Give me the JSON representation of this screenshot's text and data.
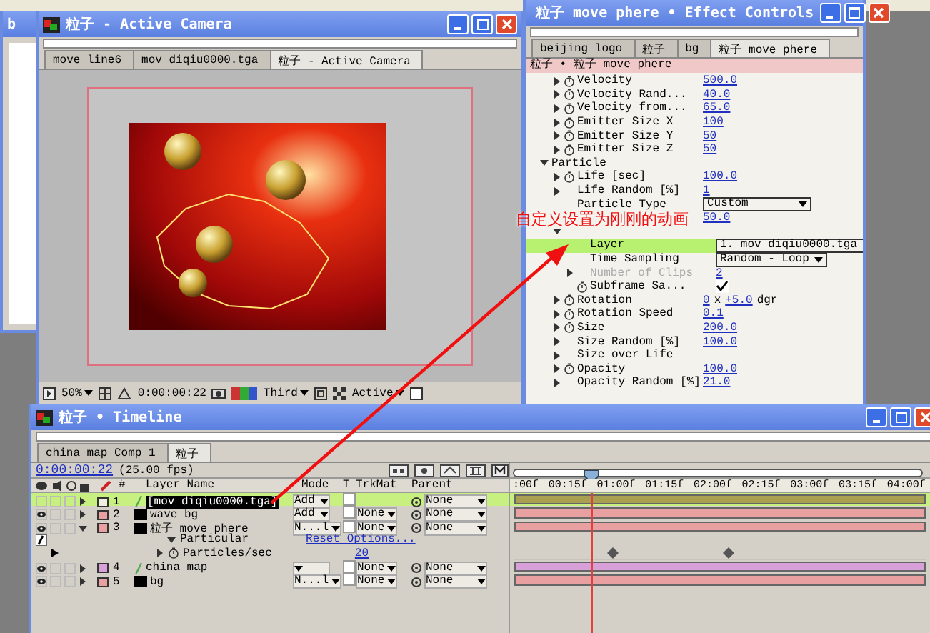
{
  "background_window": {
    "title": "b"
  },
  "camera_window": {
    "title": "粒子 - Active Camera",
    "tabs": [
      {
        "label": "move line6",
        "selected": false
      },
      {
        "label": "mov diqiu0000.tga",
        "selected": false
      },
      {
        "label": "粒子 - Active Camera",
        "selected": true
      }
    ],
    "toolbar": {
      "zoom": "50%",
      "time": "0:00:00:22",
      "resolution": "Third",
      "view": "Active"
    }
  },
  "effect_controls": {
    "title": "粒子 move phere • Effect Controls",
    "tabs": [
      {
        "label": "beijing logo",
        "selected": false
      },
      {
        "label": "粒子",
        "selected": false
      },
      {
        "label": "bg",
        "selected": false
      },
      {
        "label": "粒子 move phere",
        "selected": true
      }
    ],
    "path": "粒子 • 粒子 move phere",
    "scrolled_rows": [
      {
        "kind": "value",
        "label": "Velocity",
        "value": "500.0",
        "stopwatch": true,
        "twirl": true
      },
      {
        "kind": "value",
        "label": "Velocity Rand...",
        "value": "40.0",
        "stopwatch": true,
        "twirl": true
      },
      {
        "kind": "value",
        "label": "Velocity from...",
        "value": "65.0",
        "stopwatch": true,
        "twirl": true
      },
      {
        "kind": "value",
        "label": "Emitter Size X",
        "value": "100",
        "stopwatch": true,
        "twirl": true
      },
      {
        "kind": "value",
        "label": "Emitter Size Y",
        "value": "50",
        "stopwatch": true,
        "twirl": true
      },
      {
        "kind": "value",
        "label": "Emitter Size Z",
        "value": "50",
        "stopwatch": true,
        "twirl": true
      }
    ],
    "groups": [
      {
        "label": "Particle",
        "expanded": true,
        "children": [
          {
            "kind": "value",
            "label": "Life [sec]",
            "value": "100.0",
            "stopwatch": true,
            "twirl": true
          },
          {
            "kind": "value",
            "label": "Life Random [%]",
            "value": "1",
            "stopwatch": false,
            "twirl": true
          },
          {
            "kind": "dropdown",
            "label": "Particle Type",
            "value": "Custom",
            "stopwatch": false,
            "twirl": false
          },
          {
            "kind": "value",
            "value": "50.0",
            "disabled": true
          },
          {
            "kind": "group",
            "expanded": true,
            "children": [
              {
                "kind": "dropdown",
                "label": "Layer",
                "value": "1. mov diqiu0000.tga",
                "stopwatch": false,
                "twirl": false,
                "highlighted": true
              },
              {
                "kind": "dropdown",
                "label": "Time Sampling",
                "value": "Random - Loop",
                "stopwatch": false,
                "twirl": false,
                "highlighted": false
              },
              {
                "kind": "value",
                "label": "Number of Clips",
                "value": "2",
                "stopwatch": false,
                "twirl": true,
                "disabled": true,
                "highlighted": false
              },
              {
                "kind": "checkbox",
                "label": "Subframe Sa...",
                "checked": true,
                "stopwatch": true,
                "twirl": false,
                "highlighted": false
              }
            ]
          },
          {
            "kind": "rotation",
            "label": "Rotation",
            "revolutions": "0",
            "separator": "x",
            "degrees": "+5.0",
            "unit": "dgr",
            "stopwatch": true,
            "twirl": true
          },
          {
            "kind": "value",
            "label": "Rotation Speed",
            "value": "0.1",
            "stopwatch": true,
            "twirl": true
          },
          {
            "kind": "value",
            "label": "Size",
            "value": "200.0",
            "stopwatch": true,
            "twirl": true
          },
          {
            "kind": "value",
            "label": "Size Random [%]",
            "value": "100.0",
            "stopwatch": false,
            "twirl": true
          },
          {
            "kind": "plain",
            "label": "Size over Life",
            "stopwatch": false,
            "twirl": true
          },
          {
            "kind": "value",
            "label": "Opacity",
            "value": "100.0",
            "stopwatch": true,
            "twirl": true
          },
          {
            "kind": "value",
            "label": "Opacity Random [%]",
            "value": "21.0",
            "stopwatch": false,
            "twirl": true
          }
        ]
      }
    ]
  },
  "annotation": {
    "text": "自定义设置为刚刚的动画"
  },
  "timeline": {
    "title": "粒子 • Timeline",
    "tabs": [
      {
        "label": "china map Comp 1",
        "selected": false
      },
      {
        "label": "粒子",
        "selected": true
      }
    ],
    "time": "0:00:00:22",
    "fps": "(25.00 fps)",
    "columns": [
      "#",
      "Layer Name",
      "Mode",
      "T",
      "TrkMat",
      "Parent"
    ],
    "ruler": [
      ":00f",
      "00:15f",
      "01:00f",
      "01:15f",
      "02:00f",
      "02:15f",
      "03:00f",
      "03:15f",
      "04:00f"
    ],
    "current_time_indicator": {
      "level": 0.19
    },
    "layers": [
      {
        "number": "1",
        "name": "[mov diqiu0000.tga]",
        "kind": "footage",
        "color": "#f0f0e0",
        "selected": true,
        "visible": false,
        "expanded": false,
        "mode": "Add",
        "parent": "None"
      },
      {
        "number": "2",
        "name": "wave bg",
        "kind": "solid",
        "color": "#e8a0a0",
        "selected": false,
        "visible": true,
        "expanded": false,
        "mode": "Add",
        "trkmat": "None",
        "parent": "None"
      },
      {
        "number": "3",
        "name": "粒子 move phere",
        "kind": "solid",
        "color": "#e8a0a0",
        "selected": false,
        "visible": true,
        "expanded": true,
        "mode": "N...l",
        "trkmat": "None",
        "parent": "None",
        "effects": [
          {
            "name": "Particular",
            "action": "Reset Options...",
            "children": [
              {
                "name": "Particles/sec",
                "value": "20",
                "keyframes": [
                  {
                    "level": 0.24
                  },
                  {
                    "level": 0.52
                  }
                ]
              }
            ]
          }
        ]
      },
      {
        "number": "4",
        "name": "china map",
        "kind": "footage",
        "color": "#d8a0d8",
        "selected": false,
        "visible": true,
        "expanded": false,
        "trkmat": "None",
        "parent": "None"
      },
      {
        "number": "5",
        "name": "bg",
        "kind": "solid",
        "color": "#e8a0a0",
        "selected": false,
        "visible": true,
        "expanded": false,
        "mode": "N...l",
        "trkmat": "None",
        "parent": "None"
      }
    ]
  }
}
